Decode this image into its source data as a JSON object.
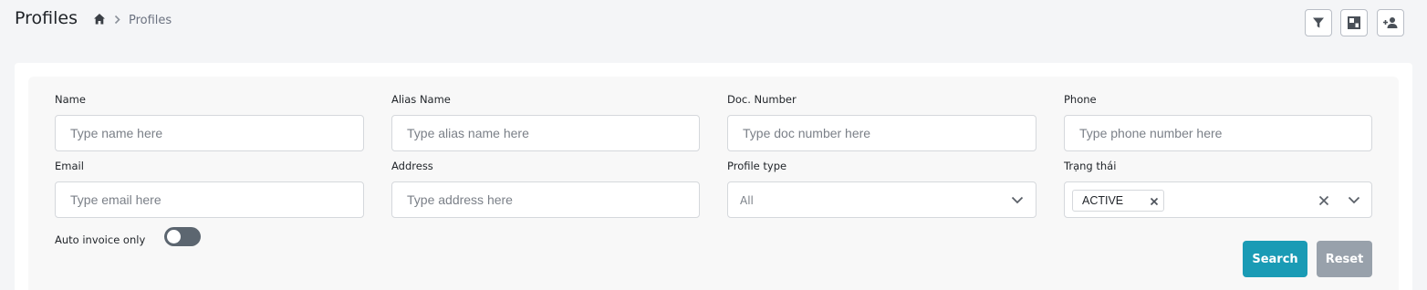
{
  "header": {
    "title": "Profiles",
    "breadcrumb_current": "Profiles"
  },
  "icons": {
    "home": "home-icon",
    "breadcrumb_separator": "chevron-right-icon",
    "filter": "filter-icon",
    "layout": "layout-icon",
    "add_user": "add-user-icon"
  },
  "filters": {
    "name": {
      "label": "Name",
      "placeholder": "Type name here",
      "value": ""
    },
    "alias_name": {
      "label": "Alias Name",
      "placeholder": "Type alias name here",
      "value": ""
    },
    "doc_number": {
      "label": "Doc. Number",
      "placeholder": "Type doc number here",
      "value": ""
    },
    "phone": {
      "label": "Phone",
      "placeholder": "Type phone number here",
      "value": ""
    },
    "email": {
      "label": "Email",
      "placeholder": "Type email here",
      "value": ""
    },
    "address": {
      "label": "Address",
      "placeholder": "Type address here",
      "value": ""
    },
    "profile_type": {
      "label": "Profile type",
      "value": "All"
    },
    "status": {
      "label": "Trạng thái",
      "selected_chip": "ACTIVE"
    },
    "auto_invoice": {
      "label": "Auto invoice only",
      "enabled": false
    }
  },
  "actions": {
    "search_label": "Search",
    "reset_label": "Reset"
  },
  "colors": {
    "page_bg": "#f4f5f7",
    "panel_bg": "#f8f8f8",
    "search_button": "#1a9bb5",
    "reset_button": "#98a1ab",
    "toggle_off": "#5c6670"
  }
}
